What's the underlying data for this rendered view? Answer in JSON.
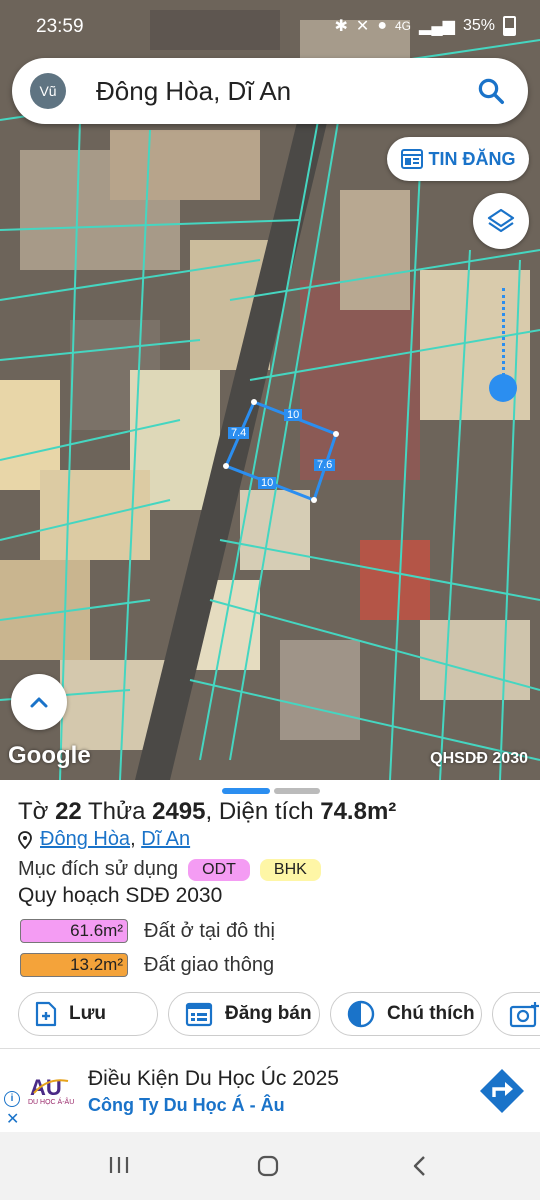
{
  "status_bar": {
    "time": "23:59",
    "network": "4G",
    "battery": "35%"
  },
  "search": {
    "avatar": "Vũ",
    "query": "Đông Hòa, Dĩ An"
  },
  "map": {
    "post_button_label": "TIN ĐĂNG",
    "google_label": "Google",
    "layer_tag": "QHSDĐ 2030",
    "plot_edges": {
      "top": "10",
      "left": "7.4",
      "right": "7.6",
      "bottom": "10"
    }
  },
  "parcel": {
    "title_prefix": "Tờ",
    "sheet_no": "22",
    "plot_word": "Thửa",
    "plot_no": "2495",
    "area_word": "Diện tích",
    "area": "74.8m²",
    "ward": "Đông Hòa",
    "district": "Dĩ An",
    "purpose_label": "Mục đích sử dụng",
    "purpose_chips": [
      "ODT",
      "BHK"
    ],
    "plan_label": "Quy hoạch SDĐ 2030",
    "plan_rows": [
      {
        "area": "61.6m²",
        "label": "Đất ở tại đô thị",
        "color": "#f49cf3"
      },
      {
        "area": "13.2m²",
        "label": "Đất giao thông",
        "color": "#f4a33a"
      }
    ]
  },
  "actions": {
    "save": "Lưu",
    "sell": "Đăng bán",
    "legend": "Chú thích"
  },
  "ad": {
    "headline": "Điều Kiện Du Học Úc 2025",
    "advertiser": "Công Ty Du Học Á - Âu",
    "logo_text": "DU HỌC Á-ÂU"
  }
}
